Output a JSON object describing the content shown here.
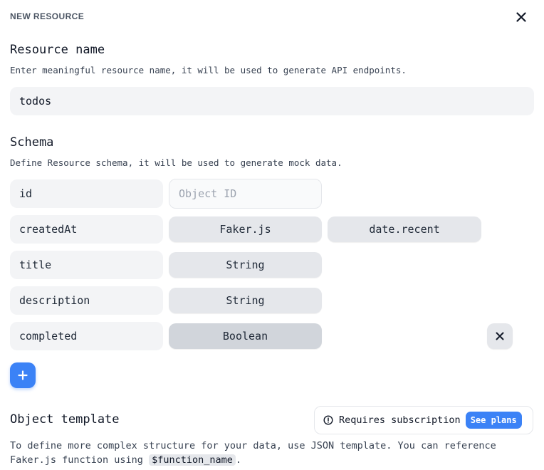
{
  "dialog": {
    "title": "NEW RESOURCE"
  },
  "resource": {
    "heading": "Resource name",
    "description": "Enter meaningful resource name, it will be used to generate API endpoints.",
    "name_value": "todos"
  },
  "schema": {
    "heading": "Schema",
    "description": "Define Resource schema, it will be used to generate mock data.",
    "fields": [
      {
        "name": "id",
        "placeholder": "Object ID"
      },
      {
        "name": "createdAt",
        "type": "Faker.js",
        "faker_method": "date.recent"
      },
      {
        "name": "title",
        "type": "String"
      },
      {
        "name": "description",
        "type": "String"
      },
      {
        "name": "completed",
        "type": "Boolean"
      }
    ]
  },
  "template": {
    "heading": "Object template",
    "subscription_label": "Requires subscription",
    "see_plans_label": "See plans",
    "description_before": "To define more complex structure for your data, use JSON template. You can reference Faker.js function using ",
    "description_code": "$function_name",
    "description_after": "."
  },
  "colors": {
    "accent": "#3b82f6",
    "field_bg": "#f3f4f6",
    "button_bg": "#e5e7eb",
    "active_button_bg": "#d1d5db"
  },
  "icons": {
    "close": "close-icon",
    "remove": "close-icon",
    "add": "plus-icon",
    "info": "info-icon"
  }
}
